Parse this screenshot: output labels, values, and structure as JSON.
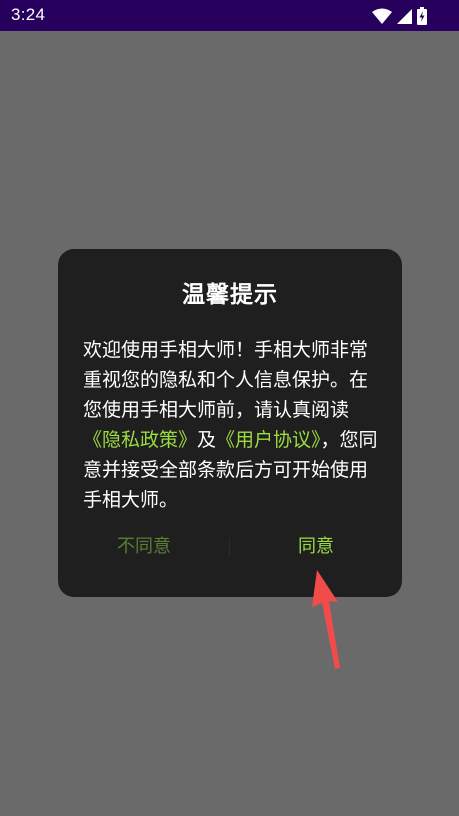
{
  "status_bar": {
    "time": "3:24",
    "icons": [
      "wifi-icon",
      "cellular-signal-icon",
      "battery-charging-icon"
    ]
  },
  "dialog": {
    "title": "温馨提示",
    "body": {
      "text_1": "欢迎使用手相大师！手相大师非常重视您的隐私和个人信息保护。在您使用手相大师前，请认真阅读",
      "privacy_link": "《隐私政策》",
      "text_2": "及",
      "terms_link": "《用户协议》",
      "text_3": "，您同意并接受全部条款后方可开始使用手相大师。"
    },
    "disagree_label": "不同意",
    "agree_label": "同意"
  },
  "colors": {
    "status_bar": "#27005e",
    "overlay": "#6a6a6a",
    "dialog_bg": "#1f1f1f",
    "link": "#9bdc3f",
    "agree": "#9bdc3f",
    "disagree": "#5f7c36",
    "arrow": "#f24b4b"
  }
}
